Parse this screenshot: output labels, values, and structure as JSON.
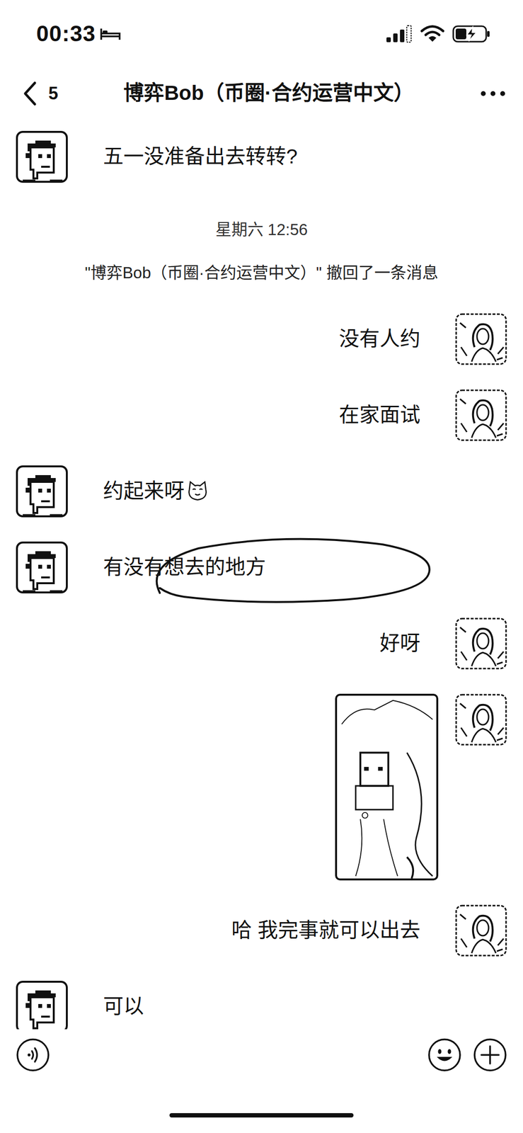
{
  "status_bar": {
    "time": "00:33"
  },
  "nav": {
    "unread": "5",
    "title": "博弈Bob（币圈·合约运营中文）"
  },
  "messages": [
    {
      "kind": "text",
      "from": "them",
      "text": "五一没准备出去转转?",
      "has_emoji": false,
      "circled": false
    },
    {
      "kind": "time",
      "text": "星期六 12:56"
    },
    {
      "kind": "system",
      "text": "\"博弈Bob（币圈·合约运营中文）\" 撤回了一条消息"
    },
    {
      "kind": "text",
      "from": "me",
      "text": "没有人约",
      "has_emoji": false,
      "circled": false
    },
    {
      "kind": "text",
      "from": "me",
      "text": "在家面试",
      "has_emoji": false,
      "circled": false
    },
    {
      "kind": "text",
      "from": "them",
      "text": "约起来呀",
      "has_emoji": true,
      "circled": false
    },
    {
      "kind": "text",
      "from": "them",
      "text": "有没有想去的地方",
      "has_emoji": false,
      "circled": true
    },
    {
      "kind": "text",
      "from": "me",
      "text": "好呀",
      "has_emoji": false,
      "circled": false
    },
    {
      "kind": "image",
      "from": "me"
    },
    {
      "kind": "text",
      "from": "me",
      "text": "哈 我完事就可以出去",
      "has_emoji": false,
      "circled": false
    },
    {
      "kind": "text",
      "from": "them",
      "text": "可以",
      "has_emoji": false,
      "circled": false
    }
  ]
}
